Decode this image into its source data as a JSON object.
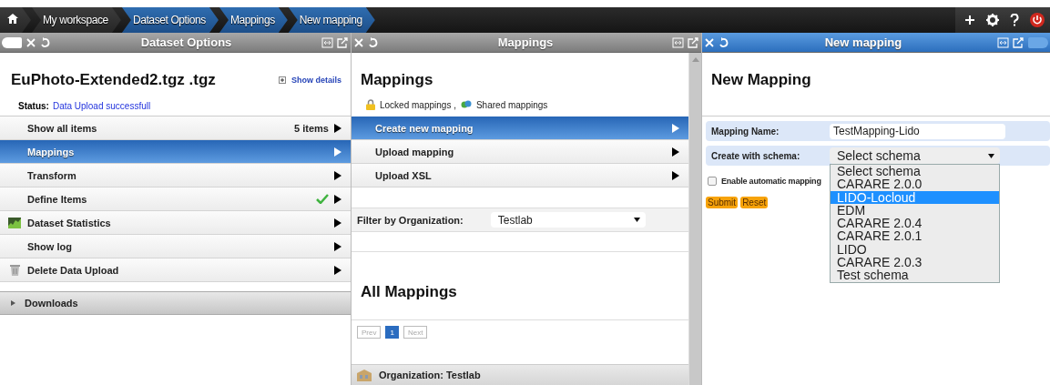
{
  "breadcrumbs": [
    {
      "label": "My workspace",
      "kind": "root"
    },
    {
      "label": "Dataset Options",
      "kind": "path"
    },
    {
      "label": "Mappings",
      "kind": "path"
    },
    {
      "label": "New mapping",
      "kind": "path"
    }
  ],
  "dataset_panel": {
    "header": {
      "title": "Dataset Options",
      "active": false
    },
    "title": "EuPhoto-Extended2.tgz .tgz",
    "show_details": "Show details",
    "status_label": "Status:",
    "status_value": "Data Upload successfull",
    "menu": [
      {
        "label": "Show all items",
        "kind": "plain",
        "count": "5 items",
        "done": false,
        "selected": false
      },
      {
        "label": "Mappings",
        "kind": "plain",
        "done": false,
        "selected": true
      },
      {
        "label": "Transform",
        "kind": "plain",
        "done": false,
        "selected": false
      },
      {
        "label": "Define Items",
        "kind": "plain",
        "done": true,
        "selected": false
      },
      {
        "label": "Dataset Statistics",
        "kind": "chart",
        "done": false,
        "selected": false
      },
      {
        "label": "Show log",
        "kind": "plain",
        "done": false,
        "selected": false
      },
      {
        "label": "Delete Data Upload",
        "kind": "trash",
        "done": false,
        "selected": false
      }
    ],
    "downloads": {
      "label": "Downloads",
      "expanded": false
    }
  },
  "mappings_panel": {
    "header": {
      "title": "Mappings",
      "active": false
    },
    "title": "Mappings",
    "legend_locked": "Locked mappings ,",
    "legend_shared": "Shared mappings",
    "menu": [
      {
        "label": "Create new mapping",
        "selected": true
      },
      {
        "label": "Upload mapping",
        "selected": false
      },
      {
        "label": "Upload XSL",
        "selected": false
      }
    ],
    "filter_label": "Filter by Organization:",
    "filter_value": "Testlab",
    "all_title": "All Mappings",
    "pagination": [
      {
        "label": "Prev",
        "selected": false,
        "disabled": true
      },
      {
        "label": "1",
        "selected": true,
        "disabled": false
      },
      {
        "label": "Next",
        "selected": false,
        "disabled": true
      }
    ],
    "organization": "Organization: Testlab"
  },
  "new_mapping_panel": {
    "header": {
      "title": "New mapping",
      "active": true
    },
    "title": "New Mapping",
    "name_label": "Mapping Name:",
    "name_value": "TestMapping-Lido",
    "schema_label": "Create with schema:",
    "schema_value": "Select schema",
    "schema_options": [
      {
        "label": "Select schema",
        "selected": false
      },
      {
        "label": "CARARE 2.0.0",
        "selected": false
      },
      {
        "label": "LIDO-Locloud",
        "selected": true
      },
      {
        "label": "EDM",
        "selected": false
      },
      {
        "label": "CARARE 2.0.4",
        "selected": false
      },
      {
        "label": "CARARE 2.0.1",
        "selected": false
      },
      {
        "label": "LIDO",
        "selected": false
      },
      {
        "label": "CARARE 2.0.3",
        "selected": false
      },
      {
        "label": "Test schema",
        "selected": false
      }
    ],
    "auto_label": "Enable automatic mapping",
    "auto_checked": false,
    "buttons": [
      "Submit",
      "Reset"
    ]
  }
}
